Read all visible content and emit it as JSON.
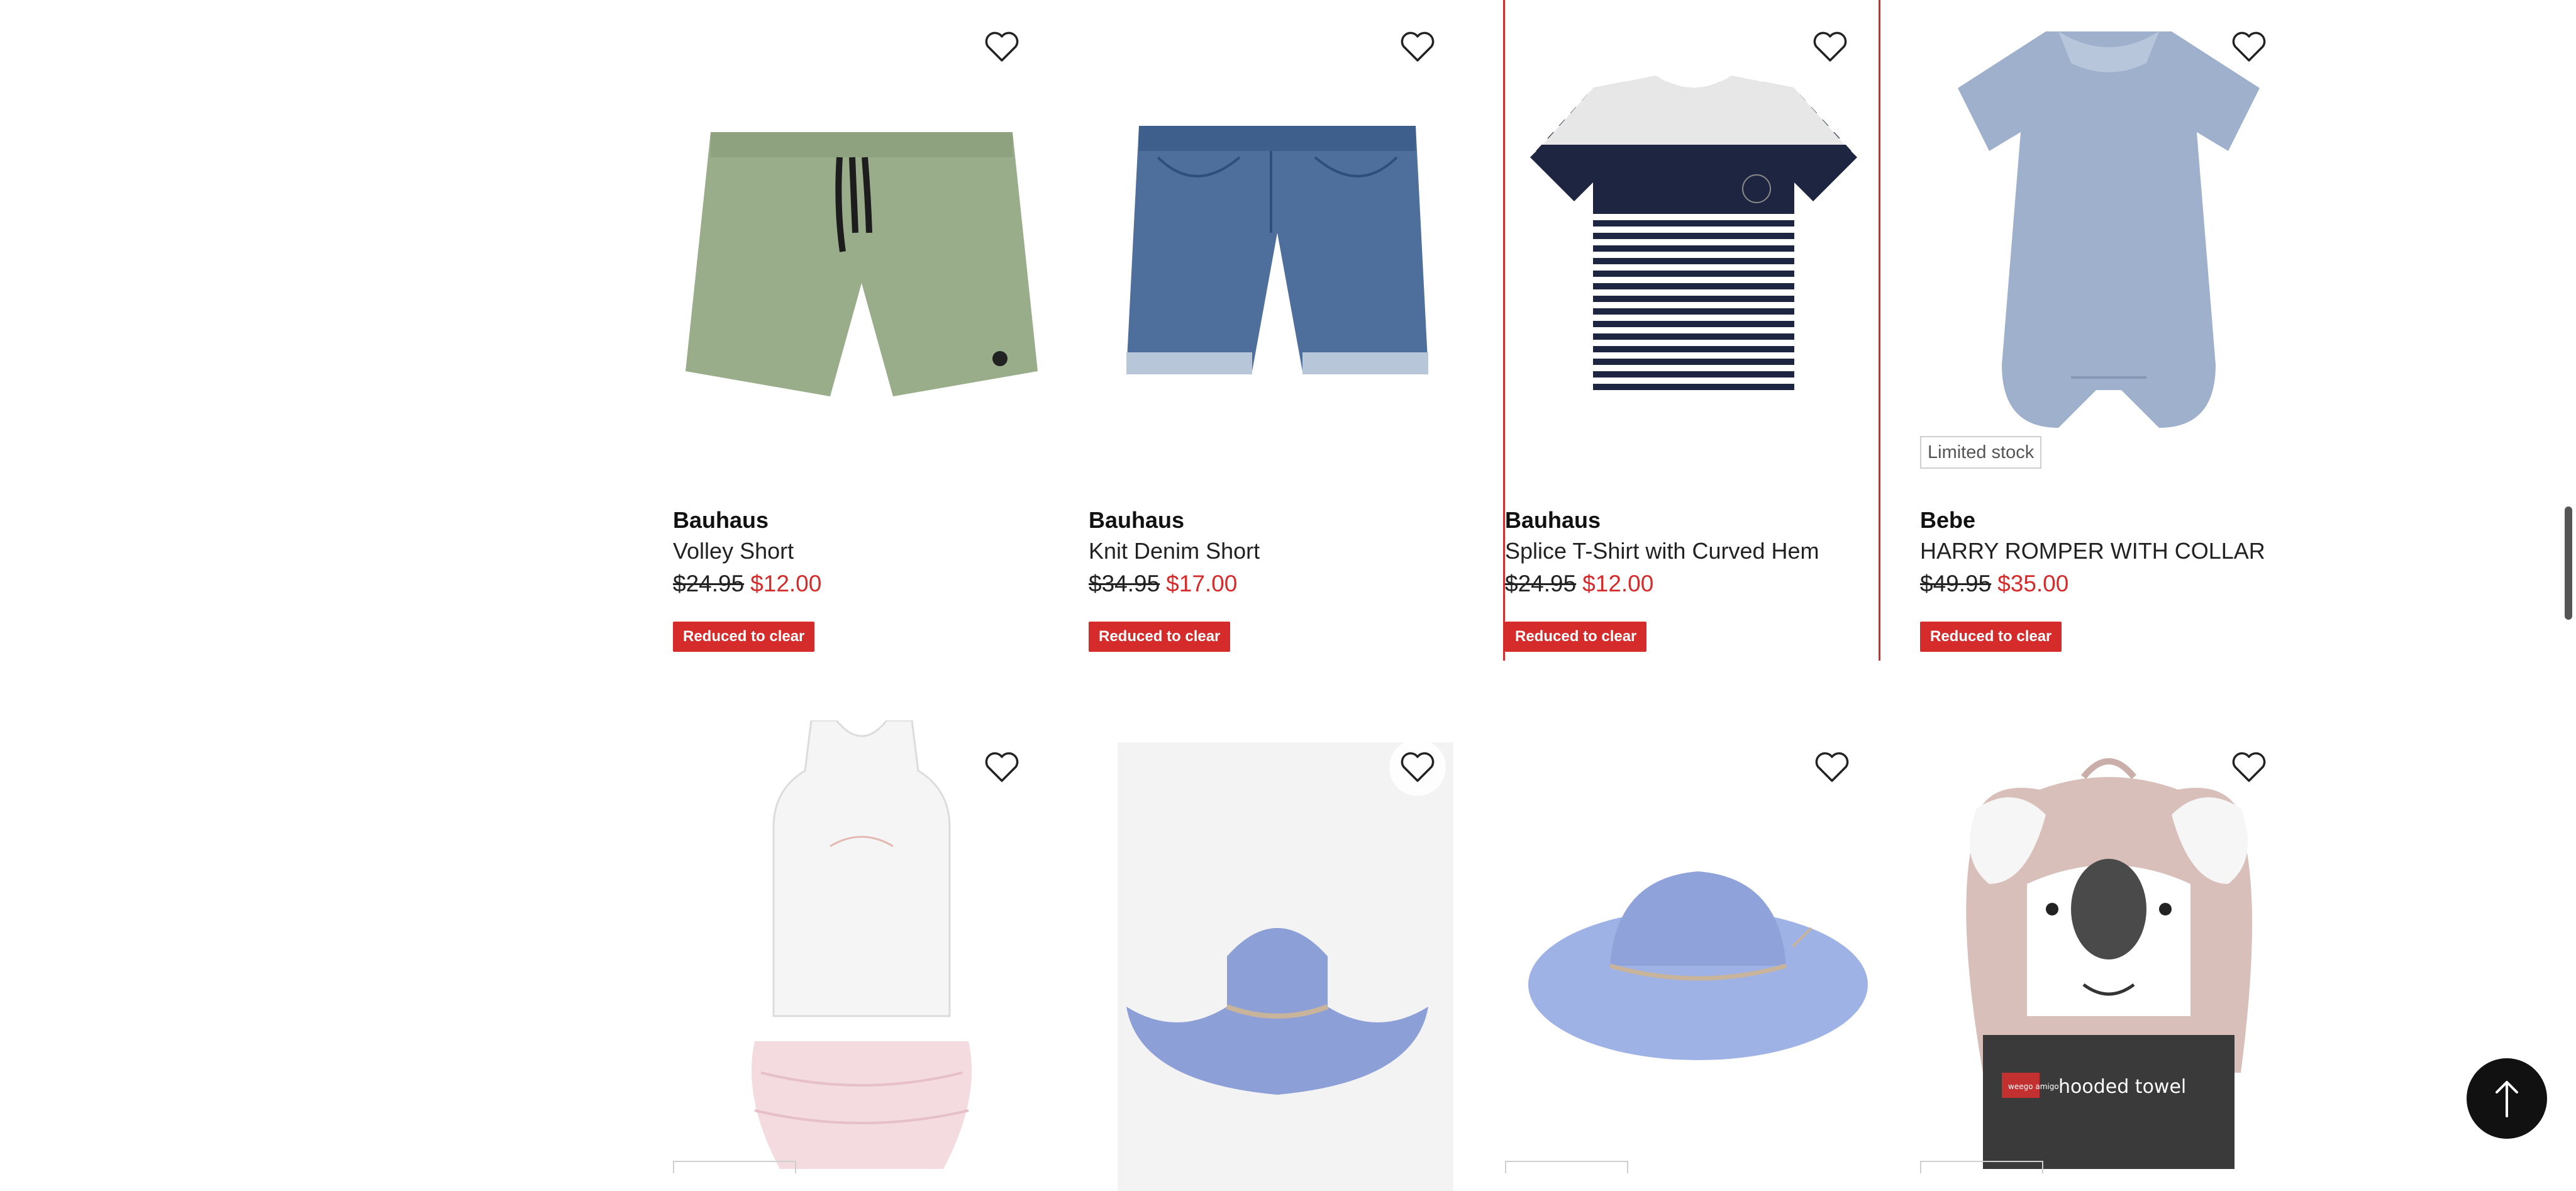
{
  "products": [
    {
      "brand": "Bauhaus",
      "name": "Volley Short",
      "was": "$24.95",
      "now": "$12.00",
      "badge": "Reduced to clear",
      "stock": ""
    },
    {
      "brand": "Bauhaus",
      "name": "Knit Denim Short",
      "was": "$34.95",
      "now": "$17.00",
      "badge": "Reduced to clear",
      "stock": ""
    },
    {
      "brand": "Bauhaus",
      "name": "Splice T-Shirt with Curved Hem",
      "was": "$24.95",
      "now": "$12.00",
      "badge": "Reduced to clear",
      "stock": ""
    },
    {
      "brand": "Bebe",
      "name": "HARRY ROMPER WITH COLLAR",
      "was": "$49.95",
      "now": "$35.00",
      "badge": "Reduced to clear",
      "stock": "Limited stock"
    }
  ],
  "towel_label": "hooded towel",
  "towel_brand": "weego amigo",
  "icons": {
    "favorite": "heart-outline-icon",
    "back_to_top": "arrow-up-icon"
  },
  "colors": {
    "sale_red": "#d62b2b",
    "text": "#1a1a1a",
    "button_dark": "#111111"
  }
}
